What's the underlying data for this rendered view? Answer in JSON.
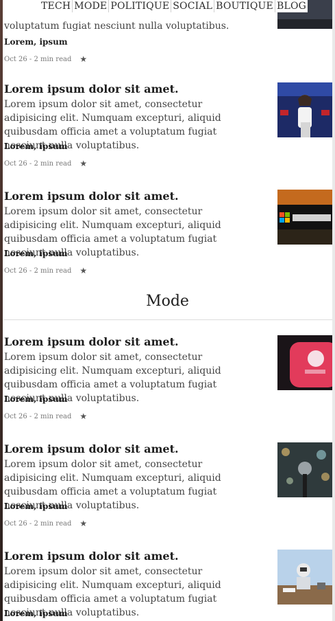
{
  "nav": {
    "items": [
      "TECH",
      "MODE",
      "POLITIQUE",
      "SOCIAL",
      "BOUTIQUE",
      "BLOG"
    ]
  },
  "partial_article": {
    "body": "voluptatum fugiat nesciunt nulla voluptatibus.",
    "categories": "Lorem, ipsum",
    "meta": "Oct 26 - 2 min read"
  },
  "articles_top": [
    {
      "title": "Lorem ipsum dolor sit amet.",
      "body": "Lorem ipsum dolor sit amet, consectetur adipisicing elit. Numquam excepturi, aliquid quibusdam officia amet a voluptatum fugiat nesciunt nulla voluptatibus.",
      "categories": "Lorem, ipsum",
      "meta": "Oct 26 - 2 min read",
      "thumb": "speaker-podium-image"
    },
    {
      "title": "Lorem ipsum dolor sit amet.",
      "body": "Lorem ipsum dolor sit amet, consectetur adipisicing elit. Numquam excepturi, aliquid quibusdam officia amet a voluptatum fugiat nesciunt nulla voluptatibus.",
      "categories": "Lorem, ipsum",
      "meta": "Oct 26 - 2 min read",
      "thumb": "microsoft-sign-image"
    }
  ],
  "section": {
    "title": "Mode"
  },
  "articles_mode": [
    {
      "title": "Lorem ipsum dolor sit amet.",
      "body": "Lorem ipsum dolor sit amet, consectetur adipisicing elit. Numquam excepturi, aliquid quibusdam officia amet a voluptatum fugiat nesciunt nulla voluptatibus.",
      "categories": "Lorem, ipsum",
      "meta": "Oct 26 - 2 min read",
      "thumb": "tinder-app-image"
    },
    {
      "title": "Lorem ipsum dolor sit amet.",
      "body": "Lorem ipsum dolor sit amet, consectetur adipisicing elit. Numquam excepturi, aliquid quibusdam officia amet a voluptatum fugiat nesciunt nulla voluptatibus.",
      "categories": "Lorem, ipsum",
      "meta": "Oct 26 - 2 min read",
      "thumb": "microphone-image"
    },
    {
      "title": "Lorem ipsum dolor sit amet.",
      "body": "Lorem ipsum dolor sit amet, consectetur adipisicing elit. Numquam excepturi, aliquid quibusdam officia amet a voluptatum fugiat nesciunt nulla voluptatibus.",
      "categories": "Lorem, ipsum",
      "meta": "",
      "thumb": "astronaut-desk-image"
    }
  ]
}
